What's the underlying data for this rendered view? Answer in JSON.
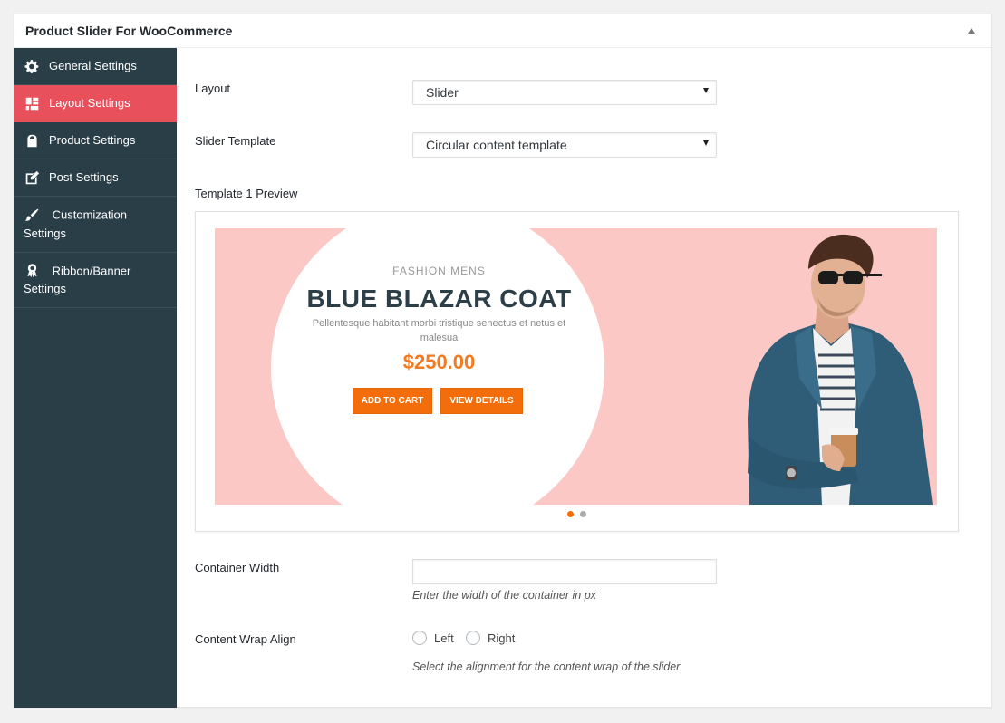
{
  "postbox": {
    "title": "Product Slider For WooCommerce"
  },
  "sidebar": {
    "items": [
      {
        "label": "General Settings",
        "icon": "gear-icon"
      },
      {
        "label": "Layout Settings",
        "icon": "layout-icon"
      },
      {
        "label": "Product Settings",
        "icon": "shop-icon"
      },
      {
        "label": "Post Settings",
        "icon": "edit-icon"
      },
      {
        "label": "Customization Settings",
        "icon": "brush-icon"
      },
      {
        "label": "Ribbon/Banner Settings",
        "icon": "award-icon"
      }
    ],
    "active_index": 1,
    "active_color": "#e8505b",
    "bg_color": "#2a3e48"
  },
  "form": {
    "layout": {
      "label": "Layout",
      "value": "Slider"
    },
    "slider_template": {
      "label": "Slider Template",
      "value": "Circular content template"
    },
    "preview_label": "Template 1 Preview",
    "container_width": {
      "label": "Container Width",
      "value": "",
      "description": "Enter the width of the container in px"
    },
    "content_wrap_align": {
      "label": "Content Wrap Align",
      "options": [
        "Left",
        "Right"
      ],
      "description": "Select the alignment for the content wrap of the slider"
    }
  },
  "preview": {
    "category": "FASHION  MENS",
    "title": "BLUE BLAZAR COAT",
    "description": "Pellentesque habitant morbi tristique senectus et netus et malesua",
    "price": "$250.00",
    "add_to_cart": "ADD TO CART",
    "view_details": "VIEW DETAILS",
    "slide_count": 2,
    "active_slide": 0,
    "accent_color": "#f36d0a",
    "banner_color": "#fbc8c6"
  }
}
